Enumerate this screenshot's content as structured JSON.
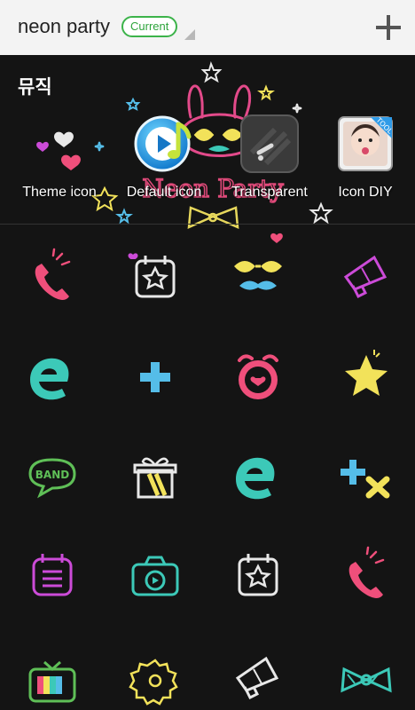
{
  "header": {
    "title": "neon party",
    "badge": "Current"
  },
  "section": {
    "title": "뮤직"
  },
  "theme_art": {
    "text": "Neon Party"
  },
  "tiles": [
    {
      "label": "Theme icon"
    },
    {
      "label": "Default icon"
    },
    {
      "label": "Transparent"
    },
    {
      "label": "Icon DIY",
      "ribbon": "TOOL"
    }
  ],
  "grid_icons": [
    "phone-icon",
    "calendar-star-icon",
    "sunglasses-mustache-icon",
    "megaphone-icon",
    "internet-e-icon",
    "plus-icon",
    "alarm-clock-icon",
    "star-icon",
    "band-chat-icon",
    "gift-icon",
    "internet-e-icon",
    "plus-x-icon",
    "notes-icon",
    "camera-icon",
    "calendar-star-icon",
    "phone-icon",
    "tv-icon",
    "settings-gear-icon",
    "megaphone-icon",
    "bow-icon"
  ],
  "colors": {
    "pink": "#ef4f7b",
    "teal": "#3cc9b8",
    "yellow": "#f2e25a",
    "blue": "#55bde8",
    "purple": "#cc4bd8",
    "white": "#e8e8e8",
    "green": "#5fbf57"
  }
}
